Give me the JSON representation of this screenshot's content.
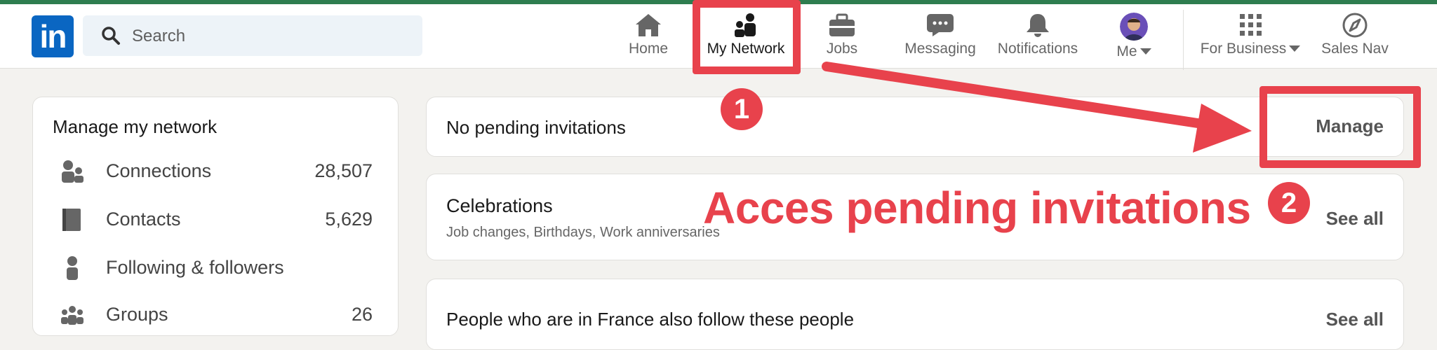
{
  "nav": {
    "search_placeholder": "Search",
    "items": [
      {
        "label": "Home",
        "icon": "home-icon"
      },
      {
        "label": "My Network",
        "icon": "network-icon"
      },
      {
        "label": "Jobs",
        "icon": "briefcase-icon"
      },
      {
        "label": "Messaging",
        "icon": "chat-icon"
      },
      {
        "label": "Notifications",
        "icon": "bell-icon"
      },
      {
        "label": "Me",
        "icon": "avatar"
      },
      {
        "label": "For Business",
        "icon": "grid-icon"
      },
      {
        "label": "Sales Nav",
        "icon": "compass-icon"
      }
    ],
    "logo_text": "in"
  },
  "sidebar": {
    "title": "Manage my network",
    "items": [
      {
        "label": "Connections",
        "count": "28,507",
        "icon": "people-icon"
      },
      {
        "label": "Contacts",
        "count": "5,629",
        "icon": "contact-book-icon"
      },
      {
        "label": "Following & followers",
        "count": "",
        "icon": "person-icon"
      },
      {
        "label": "Groups",
        "count": "26",
        "icon": "groups-icon"
      }
    ]
  },
  "invitations": {
    "text": "No pending invitations",
    "manage_label": "Manage"
  },
  "celebrations": {
    "title": "Celebrations",
    "subtitle": "Job changes, Birthdays, Work anniversaries",
    "see_all": "See all"
  },
  "people": {
    "title": "People who are in France also follow these people",
    "see_all": "See all"
  },
  "annotation": {
    "caption": "Acces pending invitations",
    "step1": "1",
    "step2": "2",
    "color": "#e8424c"
  },
  "colors": {
    "brand": "#0a66c2",
    "annotation": "#e8424c",
    "background": "#f3f2ef"
  }
}
